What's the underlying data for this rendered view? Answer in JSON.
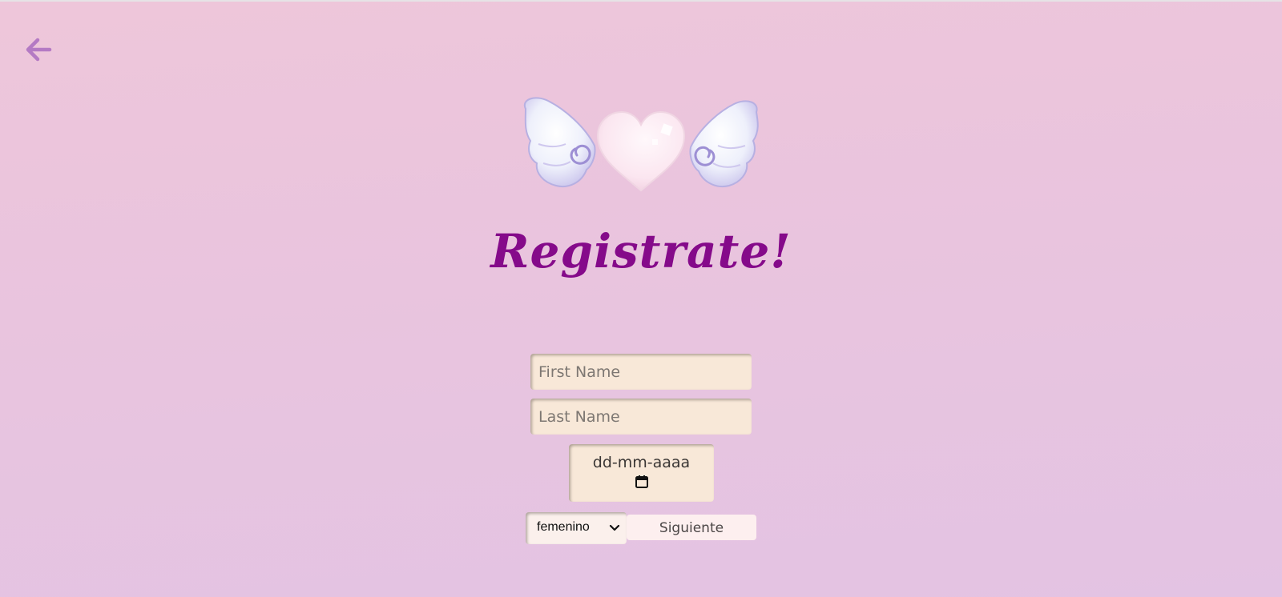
{
  "page": {
    "title": "Registrate!"
  },
  "nav": {
    "back_icon": "arrow-left-icon"
  },
  "logo": {
    "icon": "winged-heart-icon"
  },
  "form": {
    "first_name_placeholder": "First Name",
    "last_name_placeholder": "Last Name",
    "birthdate_placeholder": "dd-mm-aaaa",
    "calendar_icon": "calendar-icon",
    "gender_value": "femenino",
    "next_label": "Siguiente"
  },
  "colors": {
    "title": "#850a8a",
    "back_arrow": "#b47ac4",
    "input_bg": "#f8e8d8",
    "button_bg": "#fdefef"
  }
}
